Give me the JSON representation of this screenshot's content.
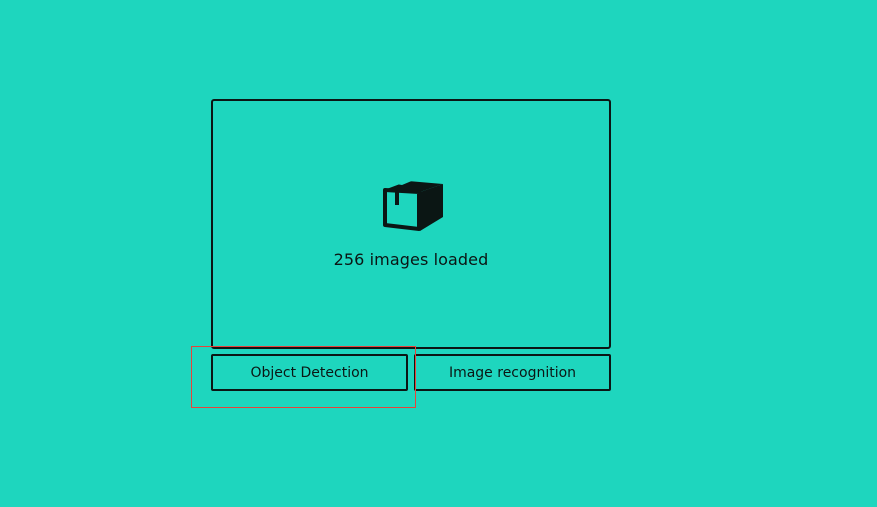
{
  "upload": {
    "icon": "package-box-icon",
    "status": "256 images loaded"
  },
  "actions": {
    "object_detection_label": "Object Detection",
    "image_recognition_label": "Image recognition"
  },
  "colors": {
    "background": "#1ed6be",
    "foreground": "#0b1614",
    "highlight": "#e8443a"
  }
}
